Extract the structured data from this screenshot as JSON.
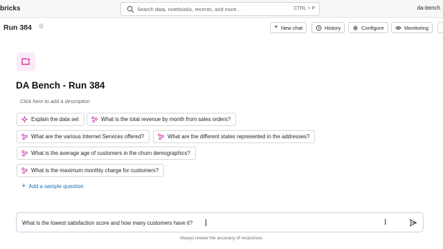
{
  "topbar": {
    "brand": "bricks",
    "search_placeholder": "Search data, notebooks, recents, and more...",
    "search_shortcut": "CTRL + P",
    "workspace": "da-bench"
  },
  "header": {
    "title": "Run 384",
    "buttons": {
      "new_chat": "New chat",
      "history": "History",
      "configure": "Configure",
      "monitoring": "Monitoring"
    }
  },
  "space": {
    "title": "DA Bench - Run 384",
    "description_placeholder": "Click here to add a description"
  },
  "chips": [
    "Explain the data set",
    "What is the total revenue by month from sales orders?",
    "What are the various Internet Services offered?",
    "What are the different states represented in the addresses?",
    "What is the average age of customers in the churn demographics?",
    "What is the maximum monthly charge for customers?"
  ],
  "add_sample_question": "Add a sample question",
  "chat": {
    "input_value": "What is the lowest satisfaction score and how many customers have it?"
  },
  "footer_note": "Always review the accuracy of responses.",
  "colors": {
    "accent": "#2272b4",
    "icon_pink": "#c2189b",
    "icon_bg": "#fbeaf7"
  }
}
